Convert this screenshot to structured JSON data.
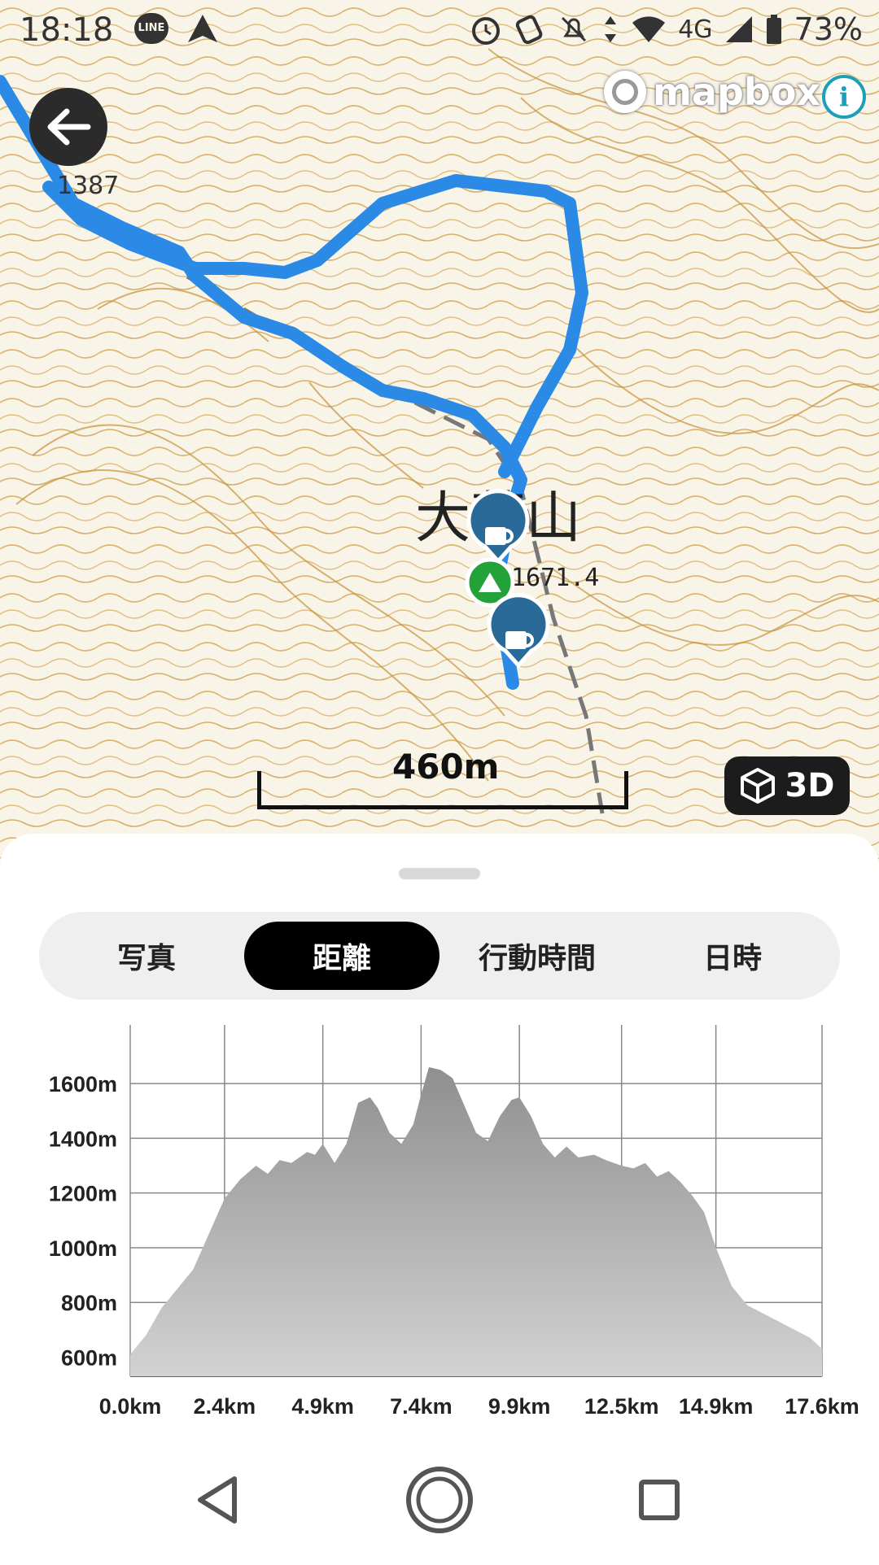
{
  "status_bar": {
    "time": "18:18",
    "battery": "73%",
    "network": "4G",
    "left_icons": [
      "line-app-icon",
      "navigation-icon"
    ],
    "right_icons": [
      "alarm-icon",
      "nfc-icon",
      "mute-icon",
      "data-arrows-icon",
      "wifi-icon",
      "signal-icon",
      "battery-icon"
    ],
    "line_label": "LINE"
  },
  "map": {
    "attribution": "mapbox",
    "info_label": "i",
    "place_name": "大菩山",
    "elevation_mark": "1671.4",
    "spot_height": "1387",
    "scale_label": "460m",
    "button_3d": "3D",
    "route_color": "#2a8ae6",
    "marker_color": "#2a6a99",
    "summit_marker_color": "#23a23a"
  },
  "tabs": [
    {
      "label": "写真",
      "active": false
    },
    {
      "label": "距離",
      "active": true
    },
    {
      "label": "行動時間",
      "active": false
    },
    {
      "label": "日時",
      "active": false
    }
  ],
  "chart_data": {
    "type": "area",
    "x_ticks": [
      "0.0km",
      "2.4km",
      "4.9km",
      "7.4km",
      "9.9km",
      "12.5km",
      "14.9km",
      "17.6km"
    ],
    "y_ticks": [
      "600m",
      "800m",
      "1000m",
      "1200m",
      "1400m",
      "1600m"
    ],
    "ylim": [
      530,
      1770
    ],
    "xlim": [
      0,
      17.6
    ],
    "x": [
      0.0,
      0.4,
      0.8,
      1.2,
      1.6,
      2.0,
      2.4,
      2.8,
      3.2,
      3.5,
      3.8,
      4.1,
      4.3,
      4.5,
      4.7,
      4.9,
      5.2,
      5.5,
      5.8,
      6.1,
      6.3,
      6.6,
      6.9,
      7.2,
      7.4,
      7.6,
      7.9,
      8.2,
      8.5,
      8.8,
      9.1,
      9.4,
      9.7,
      9.9,
      10.2,
      10.5,
      10.8,
      11.1,
      11.4,
      11.8,
      12.1,
      12.5,
      12.8,
      13.1,
      13.4,
      13.7,
      14.0,
      14.3,
      14.6,
      14.9,
      15.3,
      15.7,
      16.1,
      16.5,
      16.9,
      17.3,
      17.6
    ],
    "y": [
      610,
      680,
      780,
      850,
      920,
      1050,
      1180,
      1250,
      1300,
      1270,
      1320,
      1310,
      1330,
      1350,
      1340,
      1380,
      1310,
      1380,
      1530,
      1550,
      1510,
      1420,
      1380,
      1450,
      1560,
      1660,
      1650,
      1620,
      1520,
      1420,
      1390,
      1480,
      1540,
      1550,
      1480,
      1380,
      1330,
      1370,
      1330,
      1340,
      1320,
      1300,
      1290,
      1310,
      1260,
      1280,
      1240,
      1190,
      1130,
      1000,
      860,
      790,
      760,
      730,
      700,
      670,
      630
    ],
    "fill_color": "#b0b0b0",
    "grid": true
  },
  "nav": {
    "icons": [
      "back-nav-icon",
      "home-nav-icon",
      "recents-nav-icon"
    ]
  }
}
